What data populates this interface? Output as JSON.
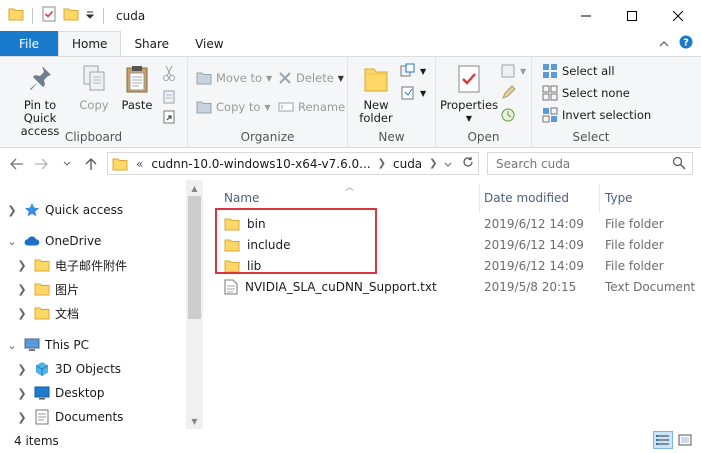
{
  "window": {
    "title": "cuda",
    "colors": {
      "accent": "#1979ca",
      "folder": "#ffd766",
      "highlight": "#d9363e"
    }
  },
  "ribbon_tabs": [
    {
      "label": "File"
    },
    {
      "label": "Home"
    },
    {
      "label": "Share"
    },
    {
      "label": "View"
    }
  ],
  "ribbon": {
    "clipboard": {
      "label": "Clipboard",
      "pin": "Pin to Quick\naccess",
      "copy": "Copy",
      "paste": "Paste"
    },
    "organize": {
      "label": "Organize",
      "move_to": "Move to",
      "copy_to": "Copy to",
      "delete": "Delete",
      "rename": "Rename"
    },
    "new": {
      "label": "New",
      "new_folder": "New\nfolder"
    },
    "open": {
      "label": "Open",
      "properties": "Properties"
    },
    "select": {
      "label": "Select",
      "select_all": "Select all",
      "select_none": "Select none",
      "invert": "Invert selection"
    }
  },
  "address": {
    "prefix": "«",
    "path_1": "cudnn-10.0-windows10-x64-v7.6.0...",
    "path_2": "cuda",
    "search_placeholder": "Search cuda"
  },
  "nav": {
    "items": [
      {
        "label": "Quick access"
      },
      {
        "label": "OneDrive"
      },
      {
        "label": "电子邮件附件"
      },
      {
        "label": "图片"
      },
      {
        "label": "文档"
      },
      {
        "label": "This PC"
      },
      {
        "label": "3D Objects"
      },
      {
        "label": "Desktop"
      },
      {
        "label": "Documents"
      }
    ]
  },
  "columns": {
    "name": "Name",
    "date": "Date modified",
    "type": "Type"
  },
  "files": [
    {
      "name": "bin",
      "date": "2019/6/12 14:09",
      "type": "File folder",
      "icon": "folder-icon"
    },
    {
      "name": "include",
      "date": "2019/6/12 14:09",
      "type": "File folder",
      "icon": "folder-icon"
    },
    {
      "name": "lib",
      "date": "2019/6/12 14:09",
      "type": "File folder",
      "icon": "folder-icon"
    },
    {
      "name": "NVIDIA_SLA_cuDNN_Support.txt",
      "date": "2019/5/8 20:15",
      "type": "Text Document",
      "icon": "text-file-icon"
    }
  ],
  "status": {
    "count": "4 items"
  }
}
